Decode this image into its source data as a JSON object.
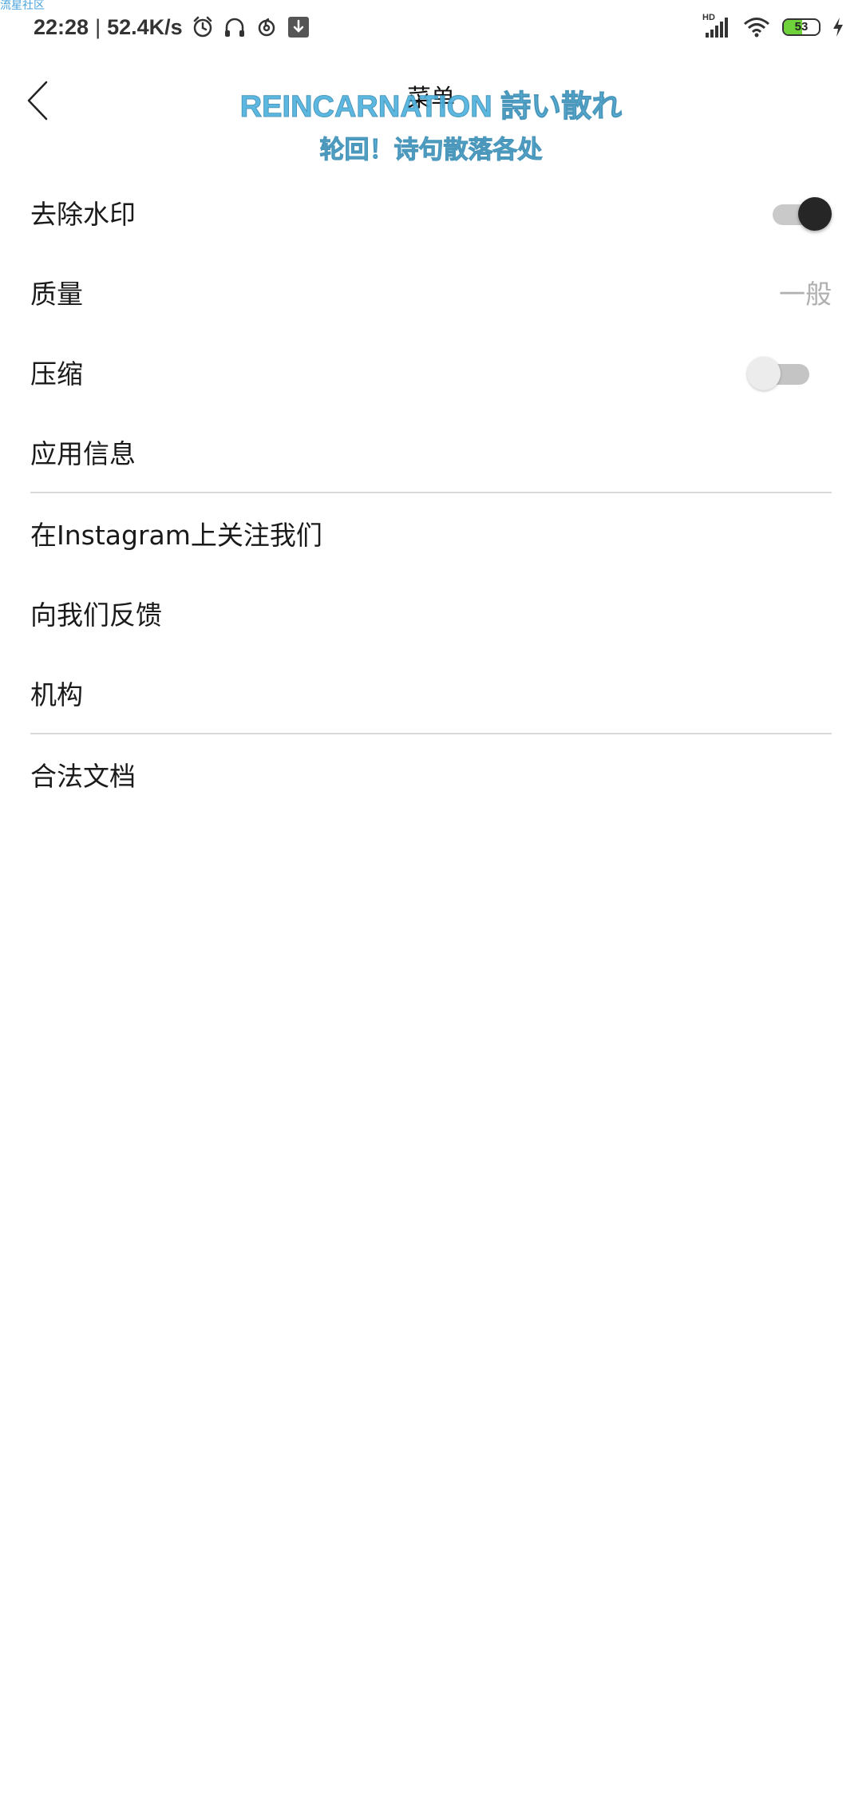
{
  "status_bar": {
    "watermark": "流星社区",
    "time": "22:28",
    "separator": "|",
    "speed": "52.4K/s",
    "icons_left": [
      "alarm-icon",
      "headset-icon",
      "netease-music-icon",
      "download-icon"
    ],
    "network_label": "HD",
    "battery_level": 53,
    "battery_text": "53",
    "battery_color": "#6fd23a",
    "icons_right": [
      "signal-icon",
      "wifi-icon",
      "battery-icon",
      "charging-icon"
    ]
  },
  "header": {
    "back_icon": "chevron-left-icon",
    "title": "菜单",
    "overlay_line1": "REINCARNATION 詩い散れ",
    "overlay_line2": "轮回！诗句散落各处",
    "overlay_color": "#4fb3de"
  },
  "settings": {
    "remove_watermark": {
      "label": "去除水印",
      "enabled": true
    },
    "quality": {
      "label": "质量",
      "value": "一般"
    },
    "compress": {
      "label": "压缩",
      "enabled": false
    },
    "app_info": {
      "label": "应用信息"
    },
    "instagram": {
      "label": "在Instagram上关注我们"
    },
    "feedback": {
      "label": "向我们反馈"
    },
    "organization": {
      "label": "机构"
    },
    "legal": {
      "label": "合法文档"
    }
  }
}
